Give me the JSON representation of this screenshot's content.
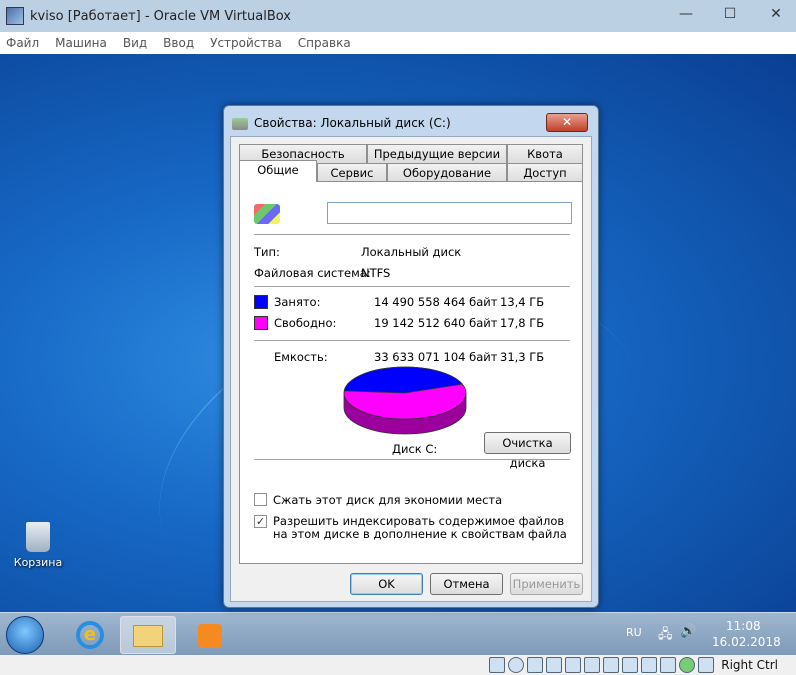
{
  "window": {
    "title": "kviso [Работает] - Oracle VM VirtualBox",
    "minimize": "—",
    "maximize": "☐",
    "close": "✕"
  },
  "menu": [
    "Файл",
    "Машина",
    "Вид",
    "Ввод",
    "Устройства",
    "Справка"
  ],
  "desktop": {
    "recycle_bin": "Корзина"
  },
  "taskbar": {
    "lang": "RU",
    "time": "11:08",
    "date": "16.02.2018"
  },
  "statusbar": {
    "host_key": "Right Ctrl"
  },
  "dialog": {
    "title": "Свойства: Локальный диск (C:)",
    "close": "✕",
    "tabs_row1": [
      "Безопасность",
      "Предыдущие версии",
      "Квота"
    ],
    "tabs_row2": [
      "Общие",
      "Сервис",
      "Оборудование",
      "Доступ"
    ],
    "active_tab": "Общие",
    "name_value": "",
    "type_label": "Тип:",
    "type_value": "Локальный диск",
    "fs_label": "Файловая система:",
    "fs_value": "NTFS",
    "used": {
      "label": "Занято:",
      "bytes": "14 490 558 464 байт",
      "size": "13,4 ГБ",
      "color": "#0000ff"
    },
    "free": {
      "label": "Свободно:",
      "bytes": "19 142 512 640 байт",
      "size": "17,8 ГБ",
      "color": "#ff00ff"
    },
    "capacity": {
      "label": "Емкость:",
      "bytes": "33 633 071 104 байт",
      "size": "31,3 ГБ"
    },
    "used_fraction": 0.431,
    "disk_label": "Диск C:",
    "cleanup_button": "Очистка диска",
    "compress_label": "Сжать этот диск для экономии места",
    "compress_checked": false,
    "index_label": "Разрешить индексировать содержимое файлов на этом диске в дополнение к свойствам файла",
    "index_checked": true,
    "ok": "OK",
    "cancel": "Отмена",
    "apply": "Применить"
  }
}
